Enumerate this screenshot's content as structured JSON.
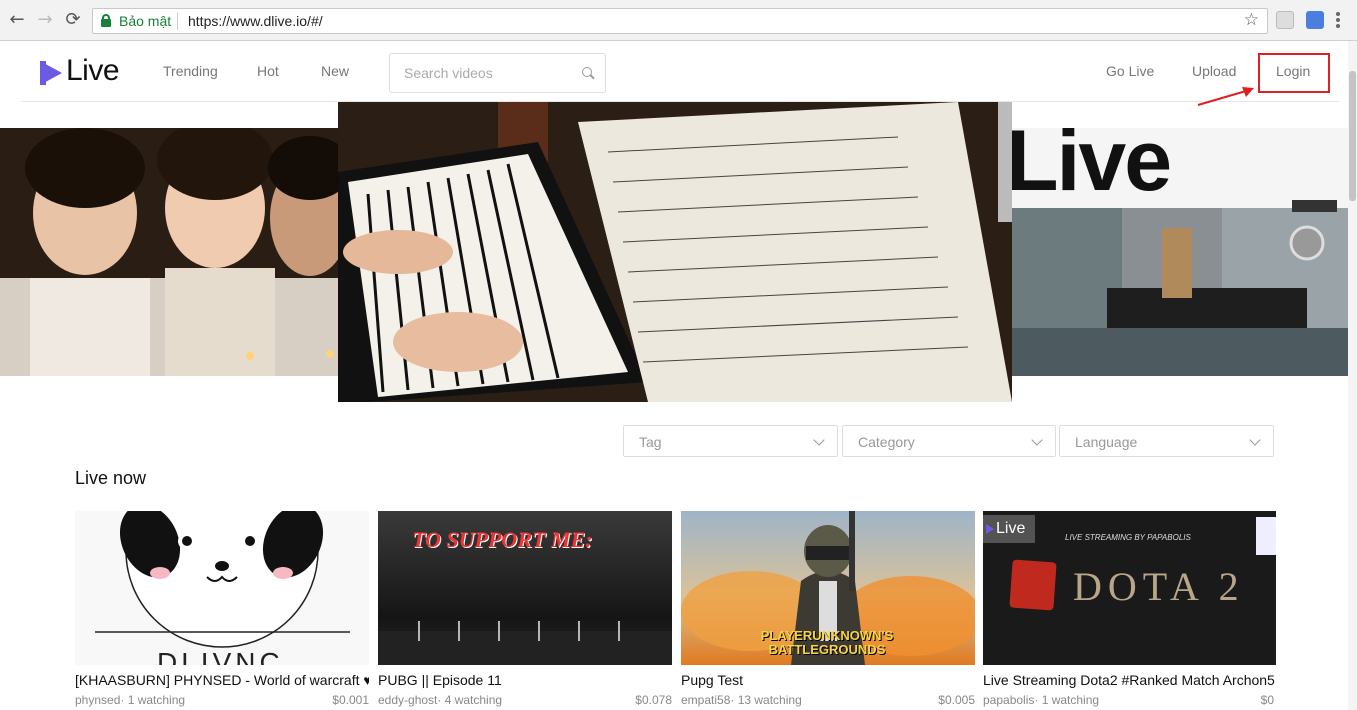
{
  "browser": {
    "secure_label": "Bảo mật",
    "url": "https://www.dlive.io/#/"
  },
  "header": {
    "logo_text": "Live",
    "nav": [
      "Trending",
      "Hot",
      "New"
    ],
    "search_placeholder": "Search videos",
    "right": {
      "go_live": "Go Live",
      "upload": "Upload",
      "login": "Login"
    }
  },
  "filters": {
    "tag": "Tag",
    "category": "Category",
    "language": "Language"
  },
  "live_now": {
    "title": "Live now",
    "cards": [
      {
        "title": "[KHAASBURN] PHYNSED - World of warcraft ♥",
        "meta": "phynsed· 1 watching",
        "price": "$0.001",
        "thumb_text": "DLIVNC"
      },
      {
        "title": "PUBG || Episode 11",
        "meta": "eddy-ghost· 4 watching",
        "price": "$0.078",
        "thumb_text": "TO SUPPORT ME:"
      },
      {
        "title": "Pupg Test",
        "meta": "empati58· 13 watching",
        "price": "$0.005",
        "thumb_text": "PLAYERUNKNOWN'S BATTLEGROUNDS"
      },
      {
        "title": "Live Streaming Dota2 #Ranked Match Archon5",
        "meta": "papabolis· 1 watching",
        "price": "$0",
        "thumb_text": "DOTA 2",
        "thumb_sub": "LIVE STREAMING BY PAPABOLIS",
        "thumb_badge": "Live"
      }
    ]
  },
  "hero": {
    "right_text": "Live"
  },
  "colors": {
    "brand": "#6b5be2",
    "highlight": "#e02020"
  }
}
